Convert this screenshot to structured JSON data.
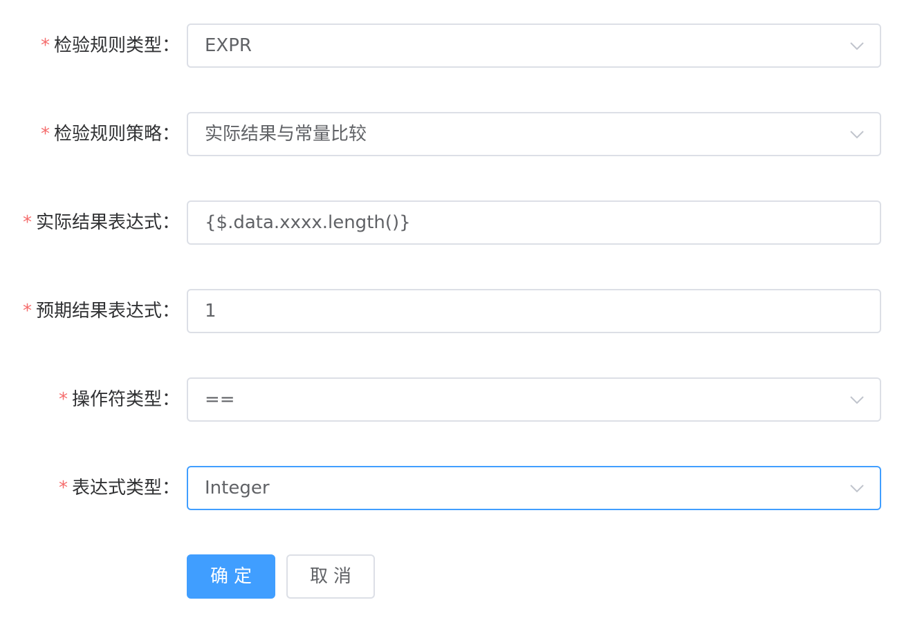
{
  "form": {
    "rule_type": {
      "label": "检验规则类型：",
      "value": "EXPR"
    },
    "rule_strategy": {
      "label": "检验规则策略：",
      "value": "实际结果与常量比较"
    },
    "actual_expr": {
      "label": "实际结果表达式：",
      "value": "{$.data.xxxx.length()}"
    },
    "expected_expr": {
      "label": "预期结果表达式：",
      "value": "1"
    },
    "operator_type": {
      "label": "操作符类型：",
      "value": "=="
    },
    "expr_type": {
      "label": "表达式类型：",
      "value": "Integer"
    },
    "required_mark": "*"
  },
  "buttons": {
    "confirm": "确定",
    "cancel": "取消"
  },
  "colors": {
    "primary": "#409eff",
    "required": "#f56c6c",
    "border": "#dcdfe6"
  }
}
